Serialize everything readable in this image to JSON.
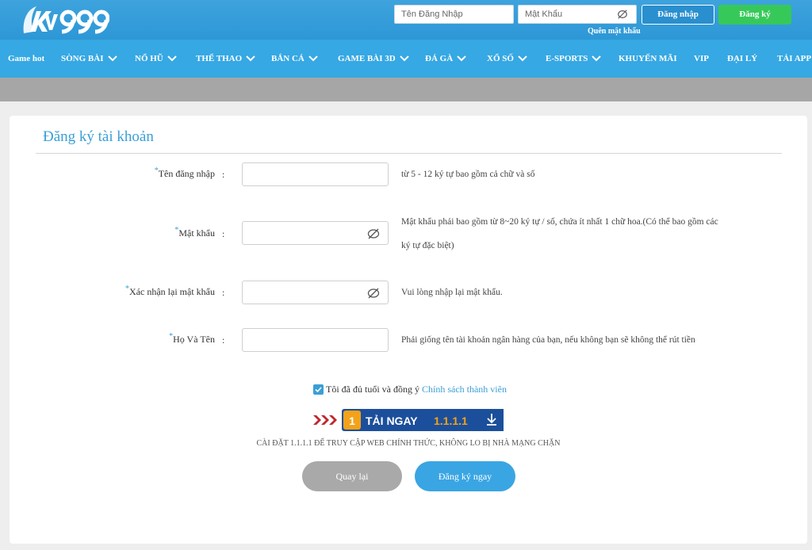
{
  "brand": {
    "logo_text": "KV999"
  },
  "header": {
    "username_placeholder": "Tên Đăng Nhập",
    "password_placeholder": "Mật Khẩu",
    "login_label": "Đăng nhập",
    "register_label": "Đăng ký",
    "forgot_label": "Quên mật khẩu"
  },
  "nav": {
    "items": [
      {
        "label": "Game hot",
        "dropdown": false
      },
      {
        "label": "SÒNG BÀI",
        "dropdown": true
      },
      {
        "label": "NỔ HŨ",
        "dropdown": true
      },
      {
        "label": "THỂ THAO",
        "dropdown": true
      },
      {
        "label": "BẮN CÁ",
        "dropdown": true
      },
      {
        "label": "GAME BÀI 3D",
        "dropdown": true
      },
      {
        "label": "ĐÁ GÀ",
        "dropdown": true
      },
      {
        "label": "XỔ SỐ",
        "dropdown": true
      },
      {
        "label": "E-SPORTS",
        "dropdown": true
      },
      {
        "label": "KHUYẾN MÃI",
        "dropdown": false
      },
      {
        "label": "VIP",
        "dropdown": false
      },
      {
        "label": "ĐẠI LÝ",
        "dropdown": false
      },
      {
        "label": "TẢI APP",
        "dropdown": false
      }
    ]
  },
  "form": {
    "title": "Đăng ký tài khoản",
    "fields": [
      {
        "label": "Tên đăng nhập",
        "value": "",
        "hint": "từ 5 - 12 ký tự bao gồm cả chữ và số"
      },
      {
        "label": "Mật khẩu",
        "value": "",
        "hint_line1": "Mật khẩu phải bao gồm từ 8~20 ký tự / số, chứa ít nhất 1 chữ hoa.(Có thể bao gồm các",
        "hint_line2": "ký tự đặc biệt)"
      },
      {
        "label": "Xác nhận lại mật khẩu",
        "value": "",
        "hint": "Vui lòng nhập lại mật khẩu."
      },
      {
        "label": "Họ Và Tên",
        "value": "",
        "hint": "Phải giống tên tài khoản ngân hàng của bạn, nếu không bạn sẽ không thể rút tiền"
      }
    ],
    "required_mark": "*",
    "colon": ":",
    "agree_text": "Tôi đã đủ tuổi và đồng ý",
    "agree_link": "Chính sách thành viên",
    "agree_checked": true,
    "banner": {
      "badge": "1",
      "text": "TẢI NGAY",
      "version": "1.1.1.1"
    },
    "install_note": "CÀI ĐẶT 1.1.1.1 ĐỂ TRUY CẬP WEB CHÍNH THỨC, KHÔNG LO BỊ NHÀ MẠNG CHẶN",
    "back_label": "Quay lại",
    "submit_label": "Đăng ký ngay"
  },
  "colors": {
    "header_blue": "#2d97d6",
    "nav_blue": "#36a8e3",
    "accent": "#3a9fd6",
    "register_green": "#36c95a",
    "back_gray": "#a9a9a9"
  }
}
